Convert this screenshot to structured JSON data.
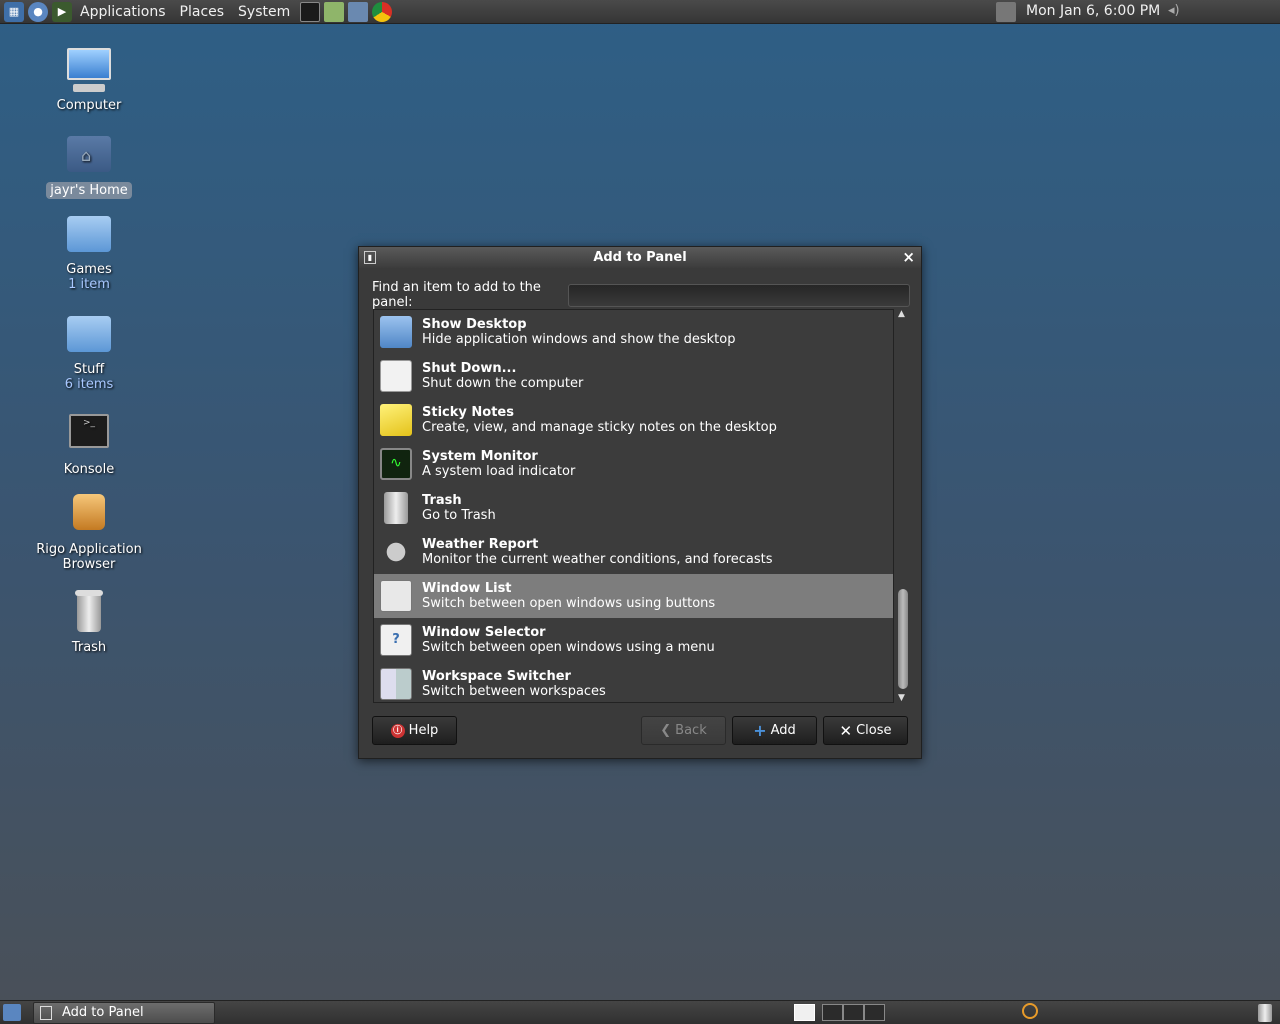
{
  "top_panel": {
    "menus": [
      "Applications",
      "Places",
      "System"
    ],
    "clock": "Mon Jan  6,  6:00 PM"
  },
  "desktop": {
    "icons": [
      {
        "label": "Computer",
        "sub": ""
      },
      {
        "label": "jayr's Home",
        "sub": ""
      },
      {
        "label": "Games",
        "sub": "1 item"
      },
      {
        "label": "Stuff",
        "sub": "6 items"
      },
      {
        "label": "Konsole",
        "sub": ""
      },
      {
        "label": "Rigo Application Browser",
        "sub": ""
      },
      {
        "label": "Trash",
        "sub": ""
      }
    ]
  },
  "dialog": {
    "title": "Add to Panel",
    "find_label": "Find an item to add to the panel:",
    "find_value": "",
    "items": [
      {
        "name": "Show Desktop",
        "desc": "Hide application windows and show the desktop",
        "icon": "show-desktop-icon"
      },
      {
        "name": "Shut Down...",
        "desc": "Shut down the computer",
        "icon": "shutdown-icon"
      },
      {
        "name": "Sticky Notes",
        "desc": "Create, view, and manage sticky notes on the desktop",
        "icon": "sticky-notes-icon"
      },
      {
        "name": "System Monitor",
        "desc": "A system load indicator",
        "icon": "system-monitor-icon"
      },
      {
        "name": "Trash",
        "desc": "Go to Trash",
        "icon": "trash-icon"
      },
      {
        "name": "Weather Report",
        "desc": "Monitor the current weather conditions, and forecasts",
        "icon": "weather-icon"
      },
      {
        "name": "Window List",
        "desc": "Switch between open windows using buttons",
        "icon": "window-list-icon"
      },
      {
        "name": "Window Selector",
        "desc": "Switch between open windows using a menu",
        "icon": "window-selector-icon"
      },
      {
        "name": "Workspace Switcher",
        "desc": "Switch between workspaces",
        "icon": "workspace-switcher-icon"
      }
    ],
    "selected_index": 6,
    "buttons": {
      "help": "Help",
      "back": "Back",
      "add": "Add",
      "close": "Close"
    }
  },
  "bottom_panel": {
    "task": "Add to Panel"
  },
  "colors": {
    "selection": "#7d7d7d",
    "accent_blue": "#4a90d9"
  }
}
